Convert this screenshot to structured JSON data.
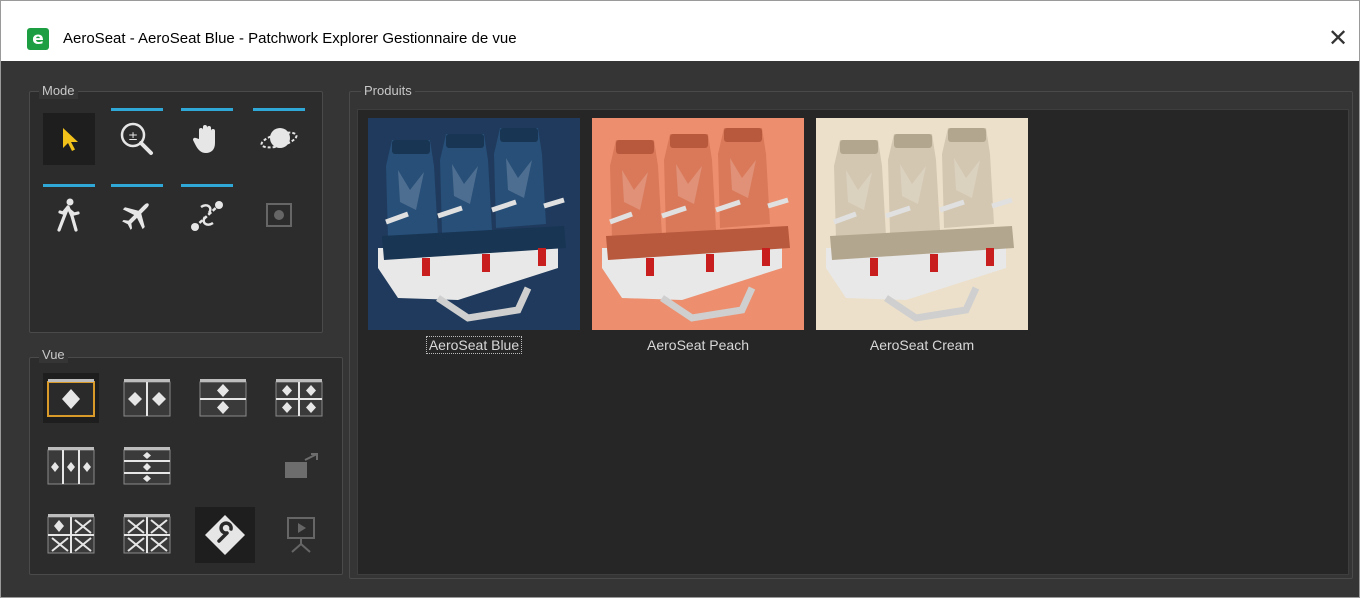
{
  "window": {
    "app_icon": "e",
    "title": "AeroSeat - AeroSeat Blue - Patchwork Explorer Gestionnaire de vue",
    "close_glyph": "✕"
  },
  "mode_panel": {
    "label": "Mode",
    "tools": [
      {
        "icon": "select-arrow-icon",
        "selected": true
      },
      {
        "icon": "zoom-icon"
      },
      {
        "icon": "pan-hand-icon"
      },
      {
        "icon": "orbit-icon"
      },
      {
        "icon": "walk-icon"
      },
      {
        "icon": "fly-airplane-icon"
      },
      {
        "icon": "link-tool-icon"
      },
      {
        "icon": "frame-icon",
        "disabled": true
      }
    ]
  },
  "view_panel": {
    "label": "Vue",
    "layouts": [
      {
        "icon": "single-view-icon",
        "selected": true
      },
      {
        "icon": "split-vertical-icon"
      },
      {
        "icon": "split-horizontal-icon"
      },
      {
        "icon": "quad-view-icon"
      },
      {
        "icon": "triple-vertical-icon"
      },
      {
        "icon": "triple-horizontal-icon"
      },
      {
        "icon": "detach-view-icon",
        "disabled": true
      },
      {
        "icon": "grid-one-three-icon"
      },
      {
        "icon": "grid-four-empty-icon"
      },
      {
        "icon": "settings-wrench-icon"
      },
      {
        "icon": "presentation-icon",
        "disabled": true
      }
    ]
  },
  "products_panel": {
    "label": "Produits",
    "items": [
      {
        "label": "AeroSeat Blue",
        "bg": "#1f3a5c",
        "seat": "#274f78",
        "seat_dark": "#183553",
        "focused": true
      },
      {
        "label": "AeroSeat Peach",
        "bg": "#ed8f6e",
        "seat": "#d9795a",
        "seat_dark": "#b8583d"
      },
      {
        "label": "AeroSeat Cream",
        "bg": "#ece0cb",
        "seat": "#d3c7b1",
        "seat_dark": "#b3a68e"
      }
    ]
  },
  "colors": {
    "accent": "#2fa8d8",
    "select_arrow": "#f3c21a",
    "selected_frame": "#d99a2a"
  }
}
